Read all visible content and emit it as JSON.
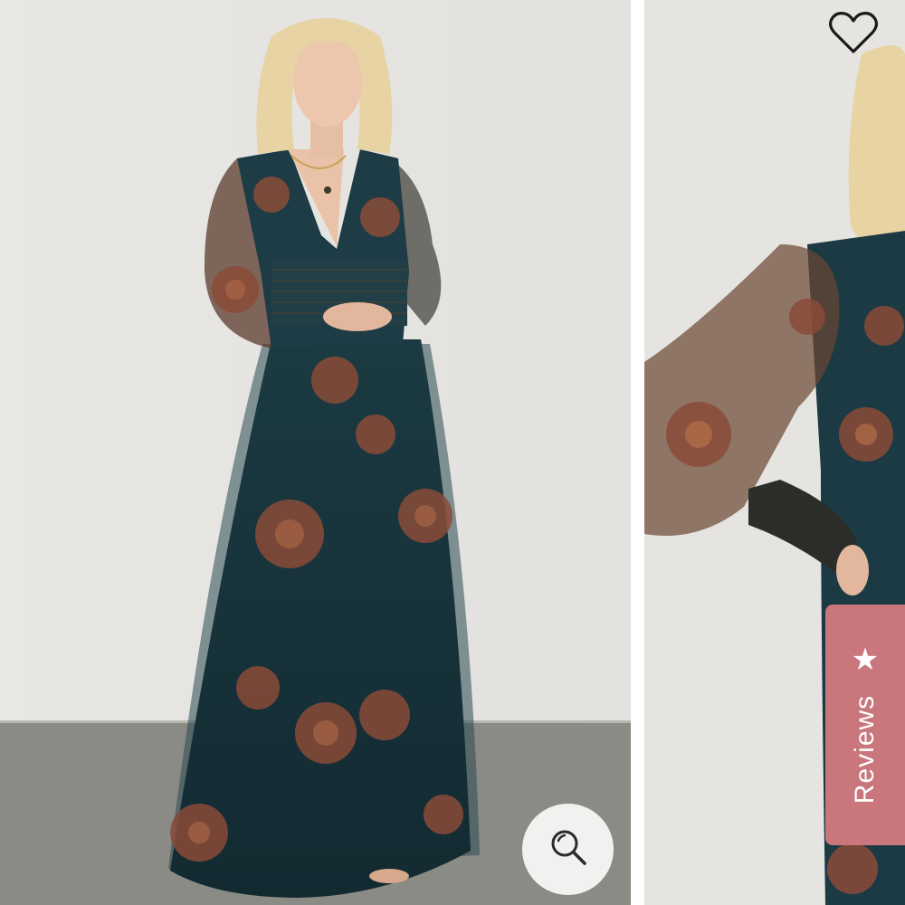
{
  "gallery": {
    "reviews_tab": {
      "label": "Reviews",
      "icon": "star-icon",
      "color": "#c9767c"
    },
    "zoom_button": {
      "icon": "magnifier-icon"
    },
    "favorite_button": {
      "icon": "heart-outline-icon"
    },
    "colors": {
      "wall": "#e6e4e1",
      "floor": "#8a8a84",
      "dress": "#18333a",
      "floral": "#8a4b38"
    }
  }
}
